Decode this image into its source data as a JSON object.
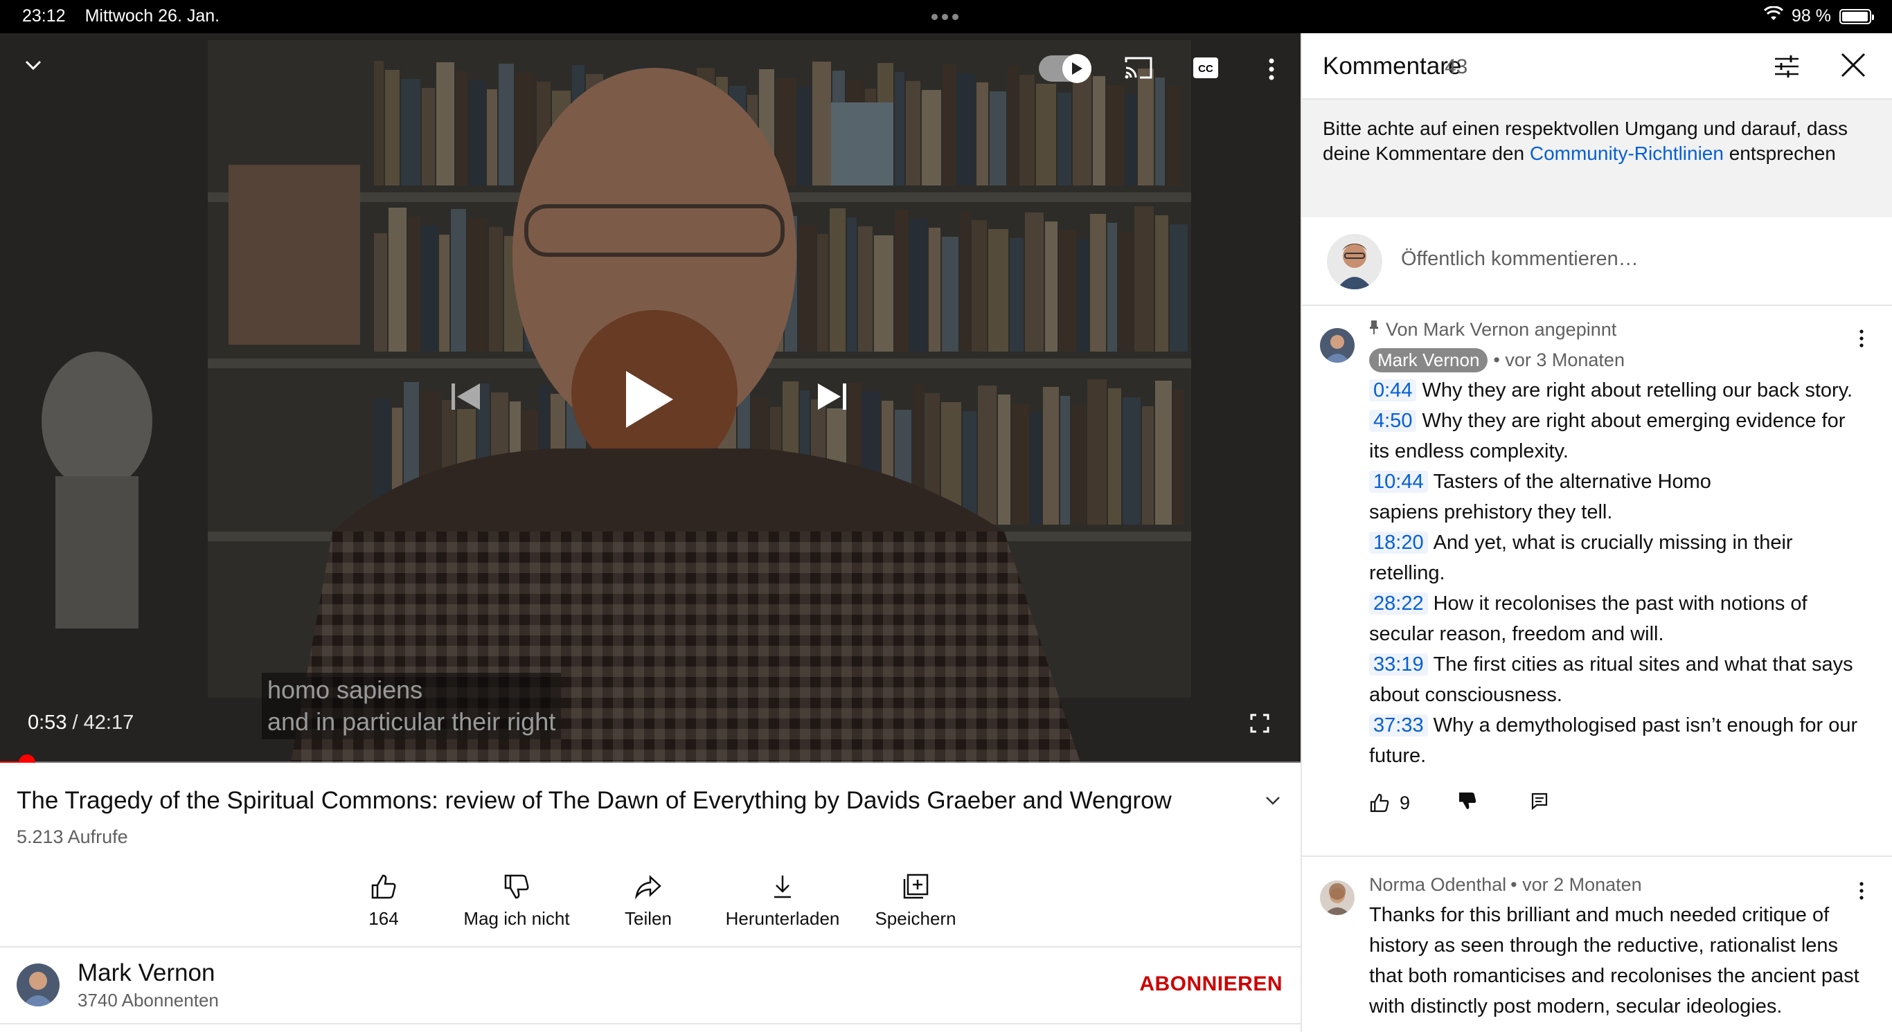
{
  "status_bar": {
    "time": "23:12",
    "date": "Mittwoch 26. Jan.",
    "battery_percent": "98 %",
    "battery_level": 0.98
  },
  "player": {
    "current_time": "0:53",
    "duration": "42:17",
    "progress": 0.021,
    "caption_line1": "homo sapiens",
    "caption_line2": "and in particular their right",
    "icons": [
      "chevron-down-icon",
      "autoplay-toggle",
      "cast-icon",
      "cc-icon",
      "more-icon",
      "previous-icon",
      "play-icon",
      "next-icon",
      "fullscreen-icon"
    ]
  },
  "video": {
    "title": "The Tragedy of the Spiritual Commons: review of The Dawn of Everything by Davids Graeber and Wengrow",
    "views": "5.213 Aufrufe"
  },
  "actions": {
    "like": "164",
    "dislike": "Mag ich nicht",
    "share": "Teilen",
    "download": "Herunterladen",
    "save": "Speichern"
  },
  "channel": {
    "name": "Mark Vernon",
    "subscribers": "3740 Abonnenten",
    "subscribe_label": "ABONNIEREN"
  },
  "comments_panel": {
    "title": "Kommentare",
    "count": "43",
    "notice_before": "Bitte achte auf einen respektvollen Umgang und darauf, dass deine Kommentare den ",
    "notice_link": "Community-Richtlinien",
    "notice_after": " entsprechen",
    "add_placeholder": "Öffentlich kommentieren…",
    "pinned_comment": {
      "pinned_by": "Von Mark Vernon angepinnt",
      "author": "Mark Vernon",
      "age": "• vor 3 Monaten",
      "chapters": [
        {
          "time": "0:44",
          "text": "Why they are right about retelling our back story."
        },
        {
          "time": "4:50",
          "text": "Why they are right about emerging evidence for its endless complexity."
        },
        {
          "time": "10:44",
          "text": "Tasters of the alternative Homo sapiens prehistory they tell."
        },
        {
          "time": "18:20",
          "text": "And yet, what is crucially missing in their retelling."
        },
        {
          "time": "28:22",
          "text": "How it recolonises the past with notions of secular reason, freedom and will."
        },
        {
          "time": "33:19",
          "text": "The first cities as ritual sites and what that says about consciousness."
        },
        {
          "time": "37:33",
          "text": "Why a demythologised past isn’t enough for our future."
        }
      ],
      "likes": "9"
    },
    "second_comment": {
      "author": "Norma Odenthal",
      "age": "• vor 2 Monaten",
      "text": "Thanks for this brilliant and much needed critique of history as seen through the reductive, rationalist lens that both romanticises and recolonises the ancient past with distinctly post modern, secular ideologies."
    }
  },
  "colors": {
    "accent_red": "#ff0000",
    "subscribe_red": "#cc0000",
    "link_blue": "#065fd4"
  }
}
